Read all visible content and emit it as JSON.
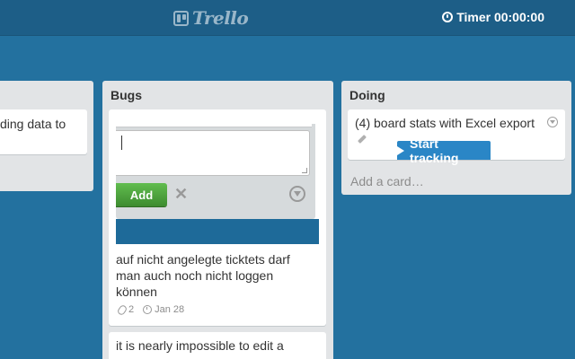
{
  "header": {
    "logo_text": "Trello",
    "timer_label": "Timer 00:00:00"
  },
  "lists": [
    {
      "title": "",
      "cards": [
        {
          "text": "ding data to"
        }
      ]
    },
    {
      "title": "Bugs",
      "composer": {
        "value": "",
        "add_label": "Add"
      },
      "cards": [
        {
          "text": "auf nicht angelegte ticktets darf\nman auch noch nicht loggen\nkönnen",
          "attachments": "2",
          "due": "Jan 28"
        },
        {
          "text": "it is nearly impossible to edit a"
        }
      ]
    },
    {
      "title": "Doing",
      "cards": [
        {
          "text": "(4) board stats with Excel export",
          "action_label": "Start tracking"
        }
      ],
      "add_card_label": "Add a card…"
    }
  ]
}
